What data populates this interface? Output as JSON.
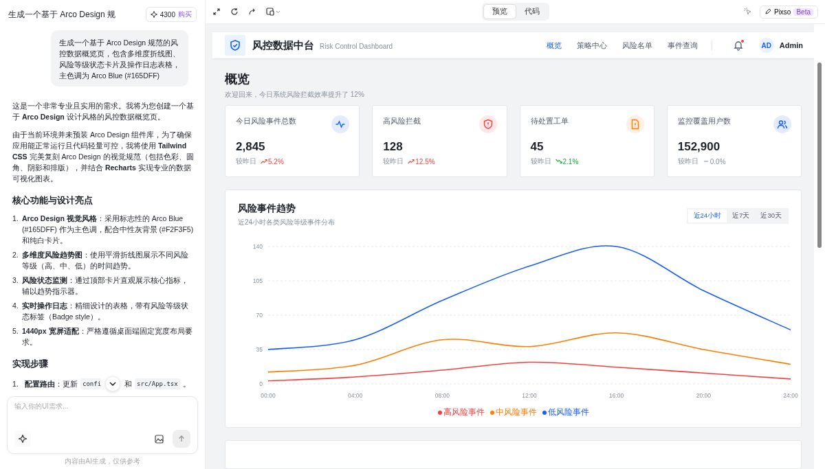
{
  "chat": {
    "title": "生成一个基于 Arco Design 规",
    "credits": "4300",
    "buy": "购买",
    "user_message": "生成一个基于 Arco Design 规范的风控数据概览页，包含多维度折线图、风险等级状态卡片及操作日志表格，主色调为 Arco Blue (#165DFF)",
    "paragraphs": [
      "这是一个非常专业且实用的需求。我将为您创建一个基于 **Arco Design** 设计风格的风控数据概览页。",
      "由于当前环境并未预装 Arco Design 组件库，为了确保应用能正常运行且代码轻量可控，我将使用 **Tailwind CSS** 完美复刻 Arco Design 的视觉规范（包括色彩、圆角、阴影和排版），并结合 **Recharts** 实现专业的数据可视化图表。"
    ],
    "features_heading": "核心功能与设计亮点",
    "features": [
      {
        "number": "1.",
        "text": "**Arco Design 视觉风格**：采用标志性的 Arco Blue (#165DFF) 作为主色调，配合中性灰背景 (#F2F3F5) 和纯白卡片。"
      },
      {
        "number": "2.",
        "text": "**多维度风险趋势图**：使用平滑折线图展示不同风险等级（高、中、低）的时间趋势。"
      },
      {
        "number": "3.",
        "text": "**风险状态监测**：通过顶部卡片直观展示核心指标，辅以趋势指示器。"
      },
      {
        "number": "4.",
        "text": "**实时操作日志**：精细设计的表格，带有风险等级状态标签（Badge style）。"
      },
      {
        "number": "5.",
        "text": "**1440px 宽屏适配**：严格遵循桌面端固定宽度布局要求。"
      }
    ],
    "steps_heading": "实现步骤",
    "steps": [
      {
        "number": "1.",
        "parts": [
          {
            "kind": "text",
            "text": "**配置路由**：更新"
          },
          {
            "kind": "code",
            "text": "confi"
          },
          {
            "kind": "text",
            "text": "和"
          },
          {
            "kind": "code",
            "text": "src/App.tsx"
          },
          {
            "kind": "text",
            "text": "。"
          }
        ]
      }
    ],
    "input": {
      "placeholder": "输入你的UI需求..."
    },
    "disclaimer": "内容由AI生成，仅供参考"
  },
  "toolbar": {
    "tabs": [
      {
        "label": "预览",
        "selected": true
      },
      {
        "label": "代码",
        "selected": false
      }
    ],
    "pixso": "Pixso",
    "beta": "Beta"
  },
  "dashboard": {
    "brand": "风控数据中台",
    "brand_sub": "Risk Control Dashboard",
    "nav": [
      {
        "label": "概览",
        "selected": true
      },
      {
        "label": "策略中心",
        "selected": false
      },
      {
        "label": "风险名单",
        "selected": false
      },
      {
        "label": "事件查询",
        "selected": false
      }
    ],
    "notification_unread": true,
    "avatar": "AD",
    "user": "Admin",
    "heading": "概览",
    "welcome": "欢迎回来，今日系统风险拦截效率提升了 12%",
    "stats": [
      {
        "label": "今日风险事件总数",
        "value": "2,845",
        "compare": "较昨日",
        "change": "5.2%",
        "kind": "up",
        "color": "#165dff"
      },
      {
        "label": "高风险拦截",
        "value": "128",
        "compare": "较昨日",
        "change": "12.5%",
        "kind": "up",
        "color": "#f53f3f"
      },
      {
        "label": "待处置工单",
        "value": "45",
        "compare": "较昨日",
        "change": "2.1%",
        "kind": "down",
        "color": "#ff7d00"
      },
      {
        "label": "监控覆盖用户数",
        "value": "152,900",
        "compare": "较昨日",
        "change": "0.0%",
        "kind": "flat",
        "color": "#165dff"
      }
    ],
    "trend": {
      "title": "风险事件趋势",
      "subtitle": "近24小时各类风险等级事件分布",
      "ranges": [
        {
          "label": "近24小时",
          "selected": true
        },
        {
          "label": "近7天",
          "selected": false
        },
        {
          "label": "近30天",
          "selected": false
        }
      ],
      "chart_data": {
        "type": "line",
        "categories": [
          "00:00",
          "04:00",
          "08:00",
          "12:00",
          "16:00",
          "20:00",
          "24:00"
        ],
        "ylim": [
          0,
          140
        ],
        "yticks": [
          0,
          35,
          70,
          105,
          140
        ],
        "grid": true,
        "legend": "bottom",
        "series": [
          {
            "name": "高风险事件",
            "color": "#f53f3f",
            "values": [
              3,
              7,
              14,
              22,
              17,
              11,
              5
            ]
          },
          {
            "name": "中风险事件",
            "color": "#ff7d00",
            "values": [
              12,
              19,
              45,
              38,
              52,
              35,
              20
            ]
          },
          {
            "name": "低风险事件",
            "color": "#165dff",
            "values": [
              35,
              45,
              85,
              120,
              140,
              95,
              55
            ]
          }
        ]
      }
    }
  }
}
